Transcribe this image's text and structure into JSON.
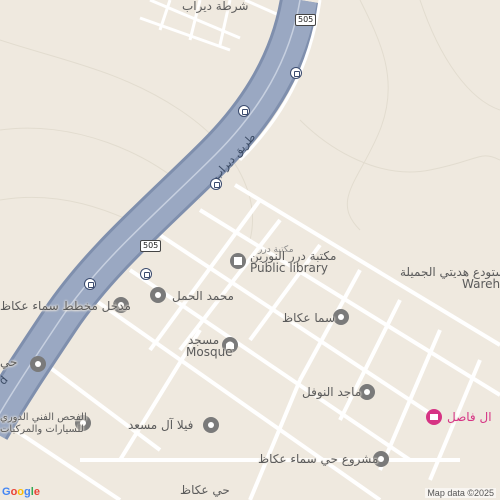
{
  "map": {
    "background": "#efe9df",
    "road_color": "#9aa8c2",
    "road_edge_color": "#7f8fad",
    "street_color": "#ffffff",
    "street_edge_color": "#d9d3c8"
  },
  "highway": {
    "name": "طريق ديراب",
    "shield_1": "505",
    "shield_2": "505"
  },
  "top_label": "شرطة ديراب",
  "places": [
    {
      "name": "مكتبة درر النورين",
      "sub": "Public library",
      "icon": "library-icon"
    },
    {
      "name": "محمد الحمل",
      "icon": "place-icon"
    },
    {
      "name": "مدخل مخطط سماء عكاظ",
      "icon": "place-icon"
    },
    {
      "name": "مسجد",
      "sub": "Mosque",
      "icon": "mosque-icon"
    },
    {
      "name": "سما عكاظ",
      "icon": "place-icon"
    },
    {
      "name": "مستودع هديتي الجميلة",
      "sub": "Wareho",
      "icon": "warehouse"
    },
    {
      "name": "ماجد النوفل",
      "icon": "place-icon"
    },
    {
      "name": "ال فاصل",
      "icon": "shop-icon",
      "color": "#d63384"
    },
    {
      "name": "فيلا آل مسعد",
      "icon": "place-icon"
    },
    {
      "name": "الفحص الفني الدوري",
      "sub": "للسيارات والمركبات",
      "icon": "place-icon"
    },
    {
      "name": "مشروع حي سماء عكاظ",
      "icon": "place-icon"
    },
    {
      "name": "حي عكاظ",
      "icon": "district"
    },
    {
      "name": "حي",
      "icon": "district"
    }
  ],
  "library_small": "مكتبة درر",
  "edge_letter": "d",
  "attribution": "Map data ©2025",
  "google_logo": "Google"
}
